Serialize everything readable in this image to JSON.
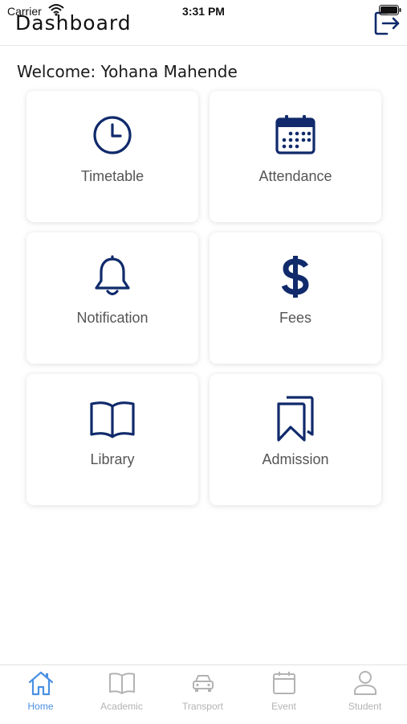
{
  "status_bar": {
    "carrier": "Carrier",
    "time": "3:31 PM"
  },
  "header": {
    "title": "Dashboard",
    "logout_icon": "logout-icon"
  },
  "welcome": "Welcome: Yohana Mahende",
  "cards": [
    {
      "label": "Timetable",
      "icon": "clock-icon"
    },
    {
      "label": "Attendance",
      "icon": "calendar-icon"
    },
    {
      "label": "Notification",
      "icon": "bell-icon"
    },
    {
      "label": "Fees",
      "icon": "dollar-icon"
    },
    {
      "label": "Library",
      "icon": "book-icon"
    },
    {
      "label": "Admission",
      "icon": "bookmarks-icon"
    }
  ],
  "tabs": [
    {
      "label": "Home",
      "icon": "home-icon",
      "active": true
    },
    {
      "label": "Academic",
      "icon": "book-icon",
      "active": false
    },
    {
      "label": "Transport",
      "icon": "car-icon",
      "active": false
    },
    {
      "label": "Event",
      "icon": "calendar-icon",
      "active": false
    },
    {
      "label": "Student",
      "icon": "person-icon",
      "active": false
    }
  ],
  "colors": {
    "icon_primary": "#102a6b",
    "tab_active": "#4a90e2",
    "tab_inactive": "#b3b3b3"
  }
}
